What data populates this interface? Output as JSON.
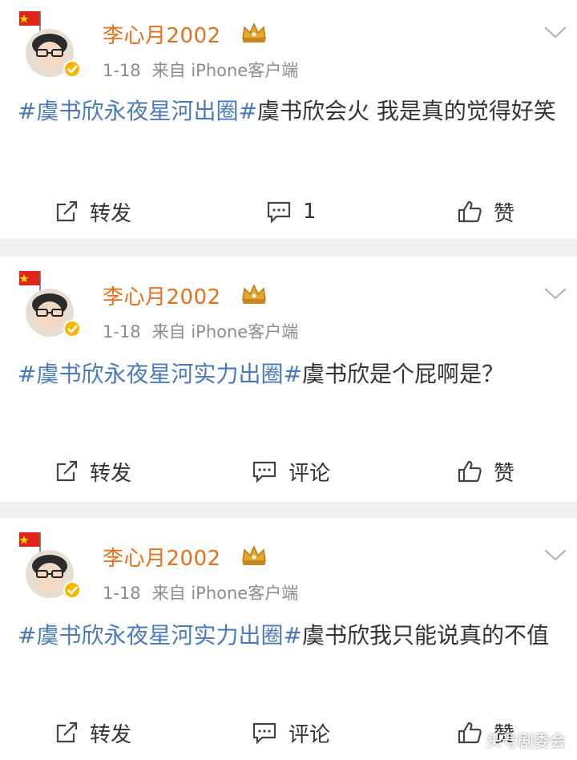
{
  "posts": [
    {
      "user": {
        "name": "李心月2002",
        "time": "1-18",
        "source": "来自 iPhone客户端"
      },
      "content": {
        "tag": "#虞书欣永夜星河出圈#",
        "text": "虞书欣会火 我是真的觉得好笑"
      },
      "actions": {
        "repost": "转发",
        "comment": "1",
        "like": "赞"
      }
    },
    {
      "user": {
        "name": "李心月2002",
        "time": "1-18",
        "source": "来自 iPhone客户端"
      },
      "content": {
        "tag": "#虞书欣永夜星河实力出圈#",
        "text": "虞书欣是个屁啊是？"
      },
      "actions": {
        "repost": "转发",
        "comment": "评论",
        "like": "赞"
      }
    },
    {
      "user": {
        "name": "李心月2002",
        "time": "1-18",
        "source": "来自 iPhone客户端"
      },
      "content": {
        "tag": "#虞书欣永夜星河实力出圈#",
        "text": "虞书欣我只能说真的不值"
      },
      "actions": {
        "repost": "转发",
        "comment": "评论",
        "like": "赞"
      }
    }
  ],
  "watermark": "头号剧委会",
  "colors": {
    "username": "#e8701a",
    "tag": "#4a7ab8",
    "meta": "#8c8c8c",
    "divider": "#f0f0f0"
  },
  "icons": [
    "avatar-flag",
    "crown-badge-icon",
    "verified-badge-icon",
    "chevron-down-icon",
    "repost-icon",
    "comment-icon",
    "like-icon"
  ]
}
